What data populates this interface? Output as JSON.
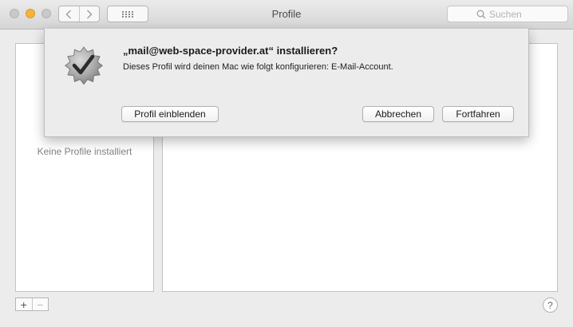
{
  "window": {
    "title": "Profile"
  },
  "search": {
    "placeholder": "Suchen"
  },
  "profiles": {
    "empty_label": "Keine Profile installiert"
  },
  "toolbar": {
    "add_label": "+",
    "remove_label": "−",
    "help_label": "?"
  },
  "sheet": {
    "title": "„mail@web-space-provider.at“ installieren?",
    "message": "Dieses Profil wird deinen Mac wie folgt konfigurieren: E-Mail-Account.",
    "show_profile_label": "Profil einblenden",
    "cancel_label": "Abbrechen",
    "continue_label": "Fortfahren"
  },
  "icons": {
    "close": "close-icon",
    "minimize": "minimize-icon",
    "maximize": "maximize-icon",
    "back": "chevron-left-icon",
    "forward": "chevron-right-icon",
    "grid": "grid-icon",
    "search": "search-icon",
    "profile": "checkmark-badge-icon"
  },
  "colors": {
    "minimize": "#f5b33c",
    "window_bg": "#ececec"
  }
}
